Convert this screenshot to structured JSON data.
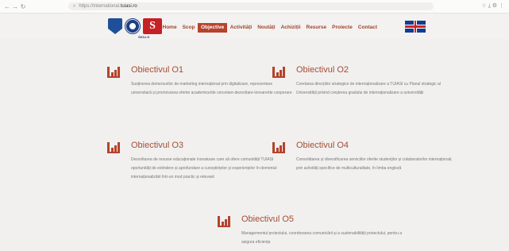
{
  "browser": {
    "back": "←",
    "forward": "→",
    "reload": "↻",
    "url_prefix": "https://international.",
    "url_domain": "tuiasi.ro",
    "tools": "☆  ⤓  ⚙  ⋮"
  },
  "header": {
    "logo_text": "S",
    "logo_sub": "SKILLS",
    "menu": [
      "Home",
      "Scop",
      "Objective",
      "Activități",
      "Noutăți",
      "Achiziții",
      "Resurse",
      "Proiecte",
      "Contact"
    ],
    "active_menu": "Objective"
  },
  "objectives": [
    {
      "title": "Obiectivul O1",
      "desc": "Susținerea demersurilor de marketing internațional prin digitalizare, reprezentare universitară și promovarea ofertei academice/de cercetare-dezvoltare-inovare/de cooperare"
    },
    {
      "title": "Obiectivul O2",
      "desc": "Corelarea direcțiilor strategice de internaționalizare a TUIASI cu Planul strategic al Universității privind creșterea gradului de internaționalizare a universității"
    },
    {
      "title": "Obiectivul O3",
      "desc": "Dezvoltarea de resurse educaționale inovatoare care să ofere comunității TUIASI oportunități de extindere și aprofundare a cunoștințelor și experiențelor în domeniul internaționalizării într-un mod practic și relevant"
    },
    {
      "title": "Obiectivul O4",
      "desc": "Consolidarea și diversificarea serviciilor oferite studenților și colaboratorilor internaționali, prin activități specifice de multiculturalitate, în limba engleză"
    },
    {
      "title": "Obiectivul O5",
      "desc": "Managementul proiectului, coordonarea comunicării și a sustenabilității proiectului, pentru a asigura eficiența"
    }
  ],
  "colors": {
    "accent": "#b5432b",
    "title": "#a64d32",
    "text": "#767676"
  }
}
